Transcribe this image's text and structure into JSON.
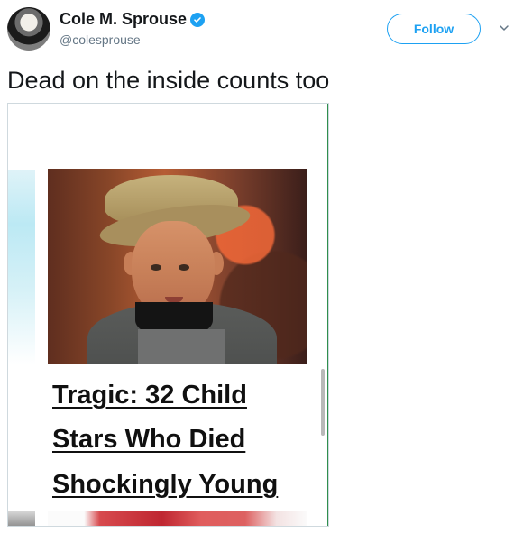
{
  "user": {
    "display_name": "Cole M. Sprouse",
    "handle": "@colesprouse"
  },
  "actions": {
    "follow_label": "Follow"
  },
  "tweet": {
    "text": "Dead on the inside counts too"
  },
  "media": {
    "headline_lines": [
      "Tragic: 32 Child",
      "Stars Who Died",
      "Shockingly Young"
    ]
  },
  "icons": {
    "verified": "verified-badge-icon",
    "more": "chevron-down-icon"
  },
  "colors": {
    "twitter_blue": "#1da1f2",
    "text_primary": "#14171a",
    "text_secondary": "#657786",
    "card_border": "#cfd9de",
    "accent_green": "#2f8f4e"
  }
}
